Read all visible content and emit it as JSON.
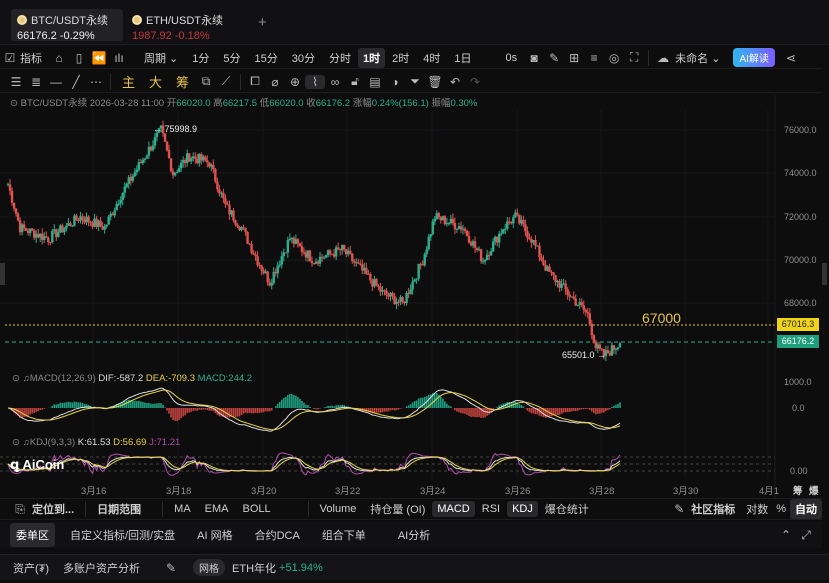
{
  "tabs": [
    {
      "name": "BTC/USDT永续",
      "price": "66176.2",
      "change": "-0.29%"
    },
    {
      "name": "ETH/USDT永续",
      "price": "1987.92",
      "change": "-0.18%"
    }
  ],
  "toolbar1": {
    "indicator": "指标",
    "period": "周期",
    "intervals": [
      "1分",
      "5分",
      "15分",
      "30分",
      "分时",
      "1时",
      "2时",
      "4时",
      "1日"
    ],
    "selected": "1时",
    "countdown": "0s",
    "layout_name": "未命名",
    "ai_label": "AI解读"
  },
  "toolbar2": {
    "main": "主",
    "big": "大",
    "chip": "筹"
  },
  "info": {
    "symbol": "BTC/USDT永续",
    "time": "2026-03-28 11:00",
    "open_label": "开",
    "open": "66020.0",
    "high_label": "高",
    "high": "66217.5",
    "low_label": "低",
    "low": "66020.0",
    "close_label": "收",
    "close": "66176.2",
    "chg_label": "涨幅",
    "chg": "0.24%(156.1)",
    "amp_label": "振幅",
    "amp": "0.30%"
  },
  "price_axis": [
    "76000.0",
    "74000.0",
    "72000.0",
    "70000.0",
    "68000.0"
  ],
  "annotations": {
    "high": "75998.9",
    "low": "65501.0",
    "level_text": "67000",
    "level_tag": "67016.3",
    "last_tag": "66176.2"
  },
  "macd": {
    "title": "MACD(12,26,9)",
    "dif": "DIF:-587.2",
    "dea": "DEA:-709.3",
    "macd": "MACD:244.2",
    "axis": [
      "1000.0",
      "0.0"
    ]
  },
  "kdj": {
    "title": "KDJ(9,3,3)",
    "k": "K:61.53",
    "d": "D:56.69",
    "j": "J:71.21",
    "axis": "0.00"
  },
  "x_axis": [
    "3月16",
    "3月18",
    "3月20",
    "3月22",
    "3月24",
    "3月26",
    "3月28",
    "3月30",
    "4月1"
  ],
  "axis_corner": [
    "筹",
    "爆"
  ],
  "logo": "AiCoin",
  "indicator_bar": {
    "locate": "定位到...",
    "range": "日期范围",
    "items": [
      "MA",
      "EMA",
      "BOLL",
      "Volume",
      "持仓量 (OI)",
      "MACD",
      "RSI",
      "KDJ",
      "爆仓统计"
    ],
    "active": [
      "MACD",
      "KDJ"
    ],
    "community": "社区指标",
    "log": "对数",
    "pct": "%",
    "auto": "自动"
  },
  "bottom_tabs": [
    "委单区",
    "自定义指标/回测/实盘",
    "AI 网格",
    "合约DCA",
    "组合下单",
    "AI分析"
  ],
  "footer": {
    "assets": "资产(₮)",
    "multi": "多账户资产分析",
    "grid": "网格",
    "eth_label": "ETH年化",
    "eth_value": "+51.94%"
  },
  "colors": {
    "up": "#2fae8c",
    "down": "#e0524f",
    "accent": "#f0c419"
  },
  "price_path": [
    [
      0,
      73500
    ],
    [
      3,
      71500
    ],
    [
      10,
      71000
    ],
    [
      18,
      72000
    ],
    [
      24,
      71500
    ],
    [
      28,
      73000
    ],
    [
      33,
      74500
    ],
    [
      38,
      75999
    ],
    [
      41,
      74000
    ],
    [
      45,
      74800
    ],
    [
      50,
      74500
    ],
    [
      54,
      72500
    ],
    [
      58,
      71500
    ],
    [
      62,
      70000
    ],
    [
      65,
      69000
    ],
    [
      70,
      71000
    ],
    [
      76,
      70000
    ],
    [
      83,
      70500
    ],
    [
      88,
      69500
    ],
    [
      93,
      68500
    ],
    [
      98,
      68000
    ],
    [
      103,
      70000
    ],
    [
      106,
      72000
    ],
    [
      113,
      71500
    ],
    [
      118,
      70000
    ],
    [
      123,
      71500
    ],
    [
      126,
      72000
    ],
    [
      130,
      71000
    ],
    [
      134,
      69500
    ],
    [
      139,
      68500
    ],
    [
      144,
      67500
    ],
    [
      146,
      66000
    ],
    [
      148,
      65600
    ],
    [
      152,
      66176
    ]
  ]
}
